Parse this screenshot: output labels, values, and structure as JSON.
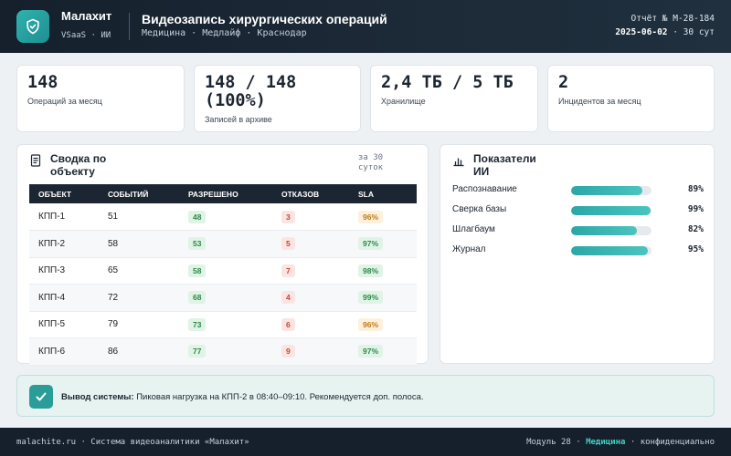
{
  "header": {
    "brand": "Малахит",
    "brand_sub": "VSaaS · ИИ",
    "title": "Видеозапись хирургических операций",
    "subtitle": "Медицина · Медлайф · Краснодар",
    "report_number": "Отчёт № M-28-184",
    "report_date": "2025-06-02",
    "report_period": " · 30 сут"
  },
  "kpis": [
    {
      "value": "148",
      "label": "Операций за месяц"
    },
    {
      "value": "148 / 148 (100%)",
      "label": "Записей в архиве"
    },
    {
      "value": "2,4 ТБ / 5 ТБ",
      "label": "Хранилище"
    },
    {
      "value": "2",
      "label": "Инцидентов за месяц"
    }
  ],
  "summary": {
    "title": "Сводка по объекту",
    "period": "за 30 суток",
    "columns": [
      "ОБЪЕКТ",
      "СОБЫТИЙ",
      "РАЗРЕШЕНО",
      "ОТКАЗОВ",
      "SLA"
    ],
    "rows": [
      {
        "object": "КПП-1",
        "events": "51",
        "allowed": "48",
        "denied": "3",
        "sla": "96%",
        "sla_status": "amber"
      },
      {
        "object": "КПП-2",
        "events": "58",
        "allowed": "53",
        "denied": "5",
        "sla": "97%",
        "sla_status": "green"
      },
      {
        "object": "КПП-3",
        "events": "65",
        "allowed": "58",
        "denied": "7",
        "sla": "98%",
        "sla_status": "green"
      },
      {
        "object": "КПП-4",
        "events": "72",
        "allowed": "68",
        "denied": "4",
        "sla": "99%",
        "sla_status": "green"
      },
      {
        "object": "КПП-5",
        "events": "79",
        "allowed": "73",
        "denied": "6",
        "sla": "96%",
        "sla_status": "amber"
      },
      {
        "object": "КПП-6",
        "events": "86",
        "allowed": "77",
        "denied": "9",
        "sla": "97%",
        "sla_status": "green"
      }
    ]
  },
  "ai": {
    "title": "Показатели ИИ",
    "metrics": [
      {
        "label": "Распознавание",
        "value": 89,
        "display": "89%"
      },
      {
        "label": "Сверка базы",
        "value": 99,
        "display": "99%"
      },
      {
        "label": "Шлагбаум",
        "value": 82,
        "display": "82%"
      },
      {
        "label": "Журнал",
        "value": 95,
        "display": "95%"
      }
    ]
  },
  "conclusion": {
    "label": "Вывод системы:",
    "text": " Пиковая нагрузка на КПП-2 в 08:40–09:10. Рекомендуется доп. полоса."
  },
  "footer": {
    "left": "malachite.ru · Система видеоаналитики «Малахит»",
    "module": "Модуль 28 · ",
    "module_highlight": "Медицина",
    "confidential": " · конфиденциально"
  },
  "colors": {
    "accent": "#2aa7a6",
    "dark": "#15202c",
    "sla_green": "#2a8a47",
    "sla_amber": "#c07a14",
    "denied_red": "#c94434"
  }
}
